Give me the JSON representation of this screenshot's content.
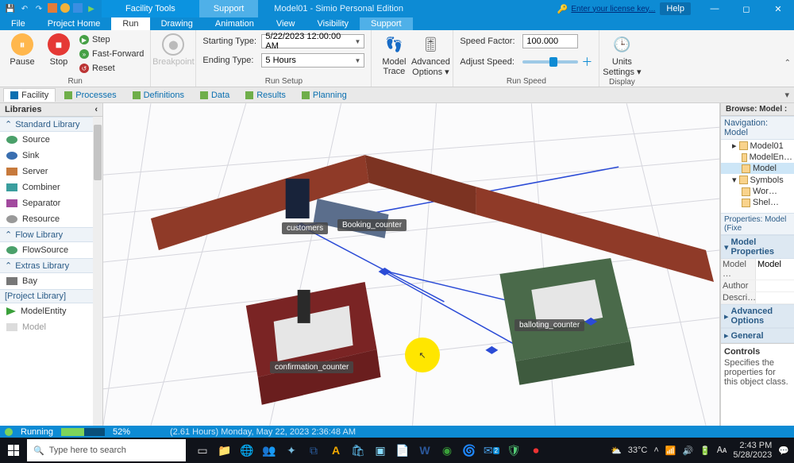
{
  "titlebar": {
    "tools_label": "Facility Tools",
    "support_label": "Support",
    "title": "Model01 - Simio Personal Edition",
    "license_link": "Enter your license key...",
    "help": "Help"
  },
  "menubar": {
    "file": "File",
    "project_home": "Project Home",
    "run": "Run",
    "drawing": "Drawing",
    "animation": "Animation",
    "view": "View",
    "visibility": "Visibility",
    "support": "Support"
  },
  "ribbon": {
    "pause": "Pause",
    "stop": "Stop",
    "step": "Step",
    "fast_forward": "Fast-Forward",
    "reset": "Reset",
    "run_group": "Run",
    "breakpoint": "Breakpoint",
    "starting_type": "Starting Type:",
    "starting_value": "5/22/2023 12:00:00 AM",
    "ending_type": "Ending Type:",
    "ending_value": "5 Hours",
    "run_setup_group": "Run Setup",
    "model_trace": "Model\nTrace",
    "advanced_options": "Advanced\nOptions ▾",
    "speed_factor": "Speed Factor:",
    "speed_value": "100.000",
    "adjust_speed": "Adjust Speed:",
    "run_speed_group": "Run Speed",
    "units_settings": "Units\nSettings ▾",
    "display_group": "Display"
  },
  "viewtabs": {
    "facility": "Facility",
    "processes": "Processes",
    "definitions": "Definitions",
    "data": "Data",
    "results": "Results",
    "planning": "Planning"
  },
  "libraries": {
    "title": "Libraries",
    "standard": "Standard Library",
    "source": "Source",
    "sink": "Sink",
    "server": "Server",
    "combiner": "Combiner",
    "separator": "Separator",
    "resource": "Resource",
    "flow": "Flow Library",
    "flowsource": "FlowSource",
    "extras": "Extras Library",
    "bay": "Bay",
    "project": "[Project Library]",
    "modelentity": "ModelEntity",
    "model": "Model"
  },
  "canvas": {
    "customers": "customers",
    "booking": "Booking_counter",
    "confirmation": "confirmation_counter",
    "balloting": "balloting_counter"
  },
  "browse": {
    "title": "Browse: Model :",
    "nav": "Navigation: Model",
    "model01": "Model01",
    "modelen": "ModelEn…",
    "model": "Model",
    "symbols": "Symbols",
    "wor": "Wor…",
    "shel": "Shel…",
    "properties_hdr": "Properties: Model (Fixe",
    "model_props": "Model Properties",
    "prop_model_k": "Model …",
    "prop_model_v": "Model",
    "prop_author": "Author",
    "prop_desc": "Descri…",
    "adv": "Advanced Options",
    "general": "General",
    "controls_hdr": "Controls",
    "controls_txt": "Specifies the properties for this object class."
  },
  "status": {
    "state": "Running",
    "percent": "52%",
    "percent_num": 52,
    "clock": "(2.61 Hours) Monday, May 22, 2023 2:36:48 AM"
  },
  "taskbar": {
    "search_placeholder": "Type here to search",
    "weather": "33°C",
    "time": "2:43 PM",
    "date": "5/28/2023"
  }
}
